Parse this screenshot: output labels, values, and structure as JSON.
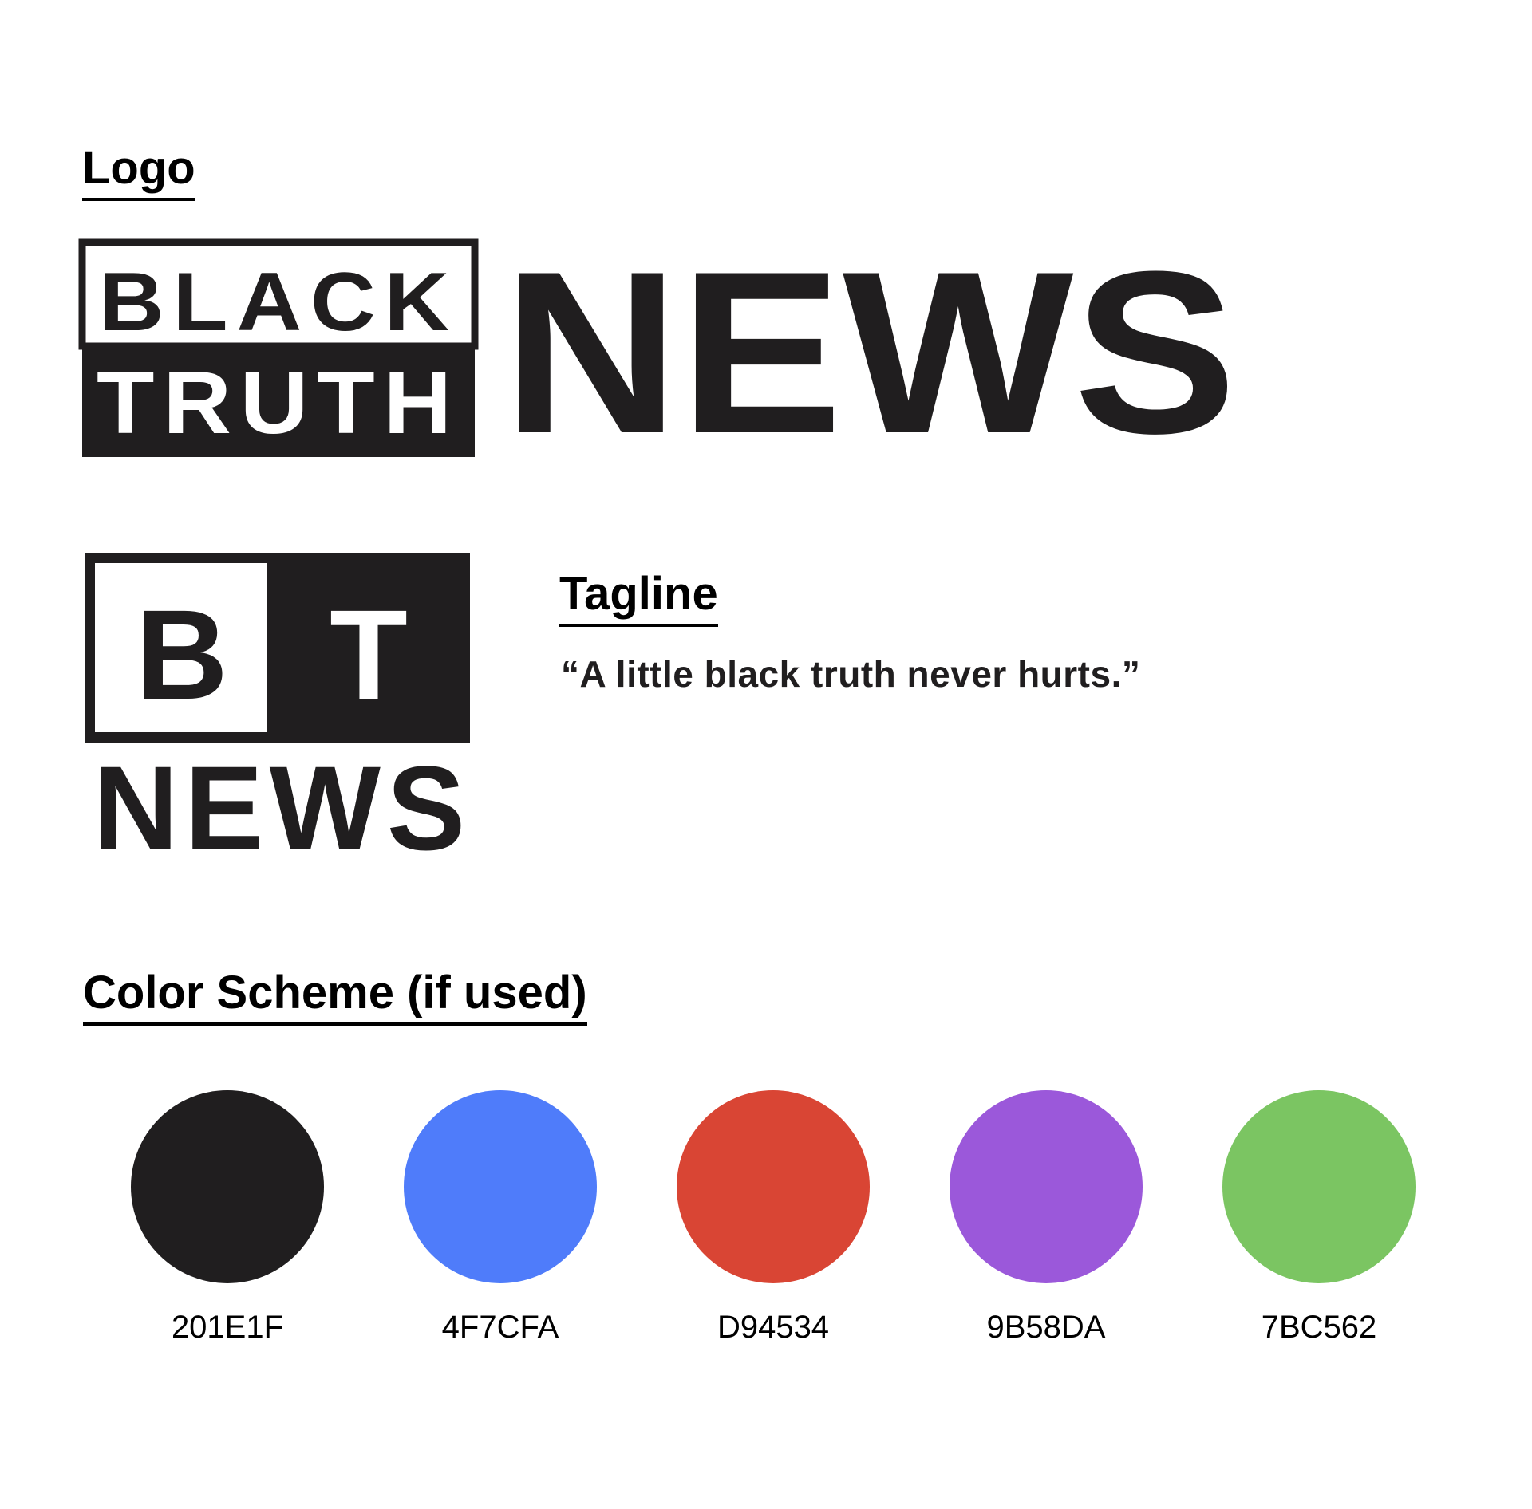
{
  "headings": {
    "logo": "Logo",
    "tagline": "Tagline",
    "color_scheme": "Color Scheme (if used)"
  },
  "logo": {
    "primary": {
      "word_black": "BLACK",
      "word_truth": "TRUTH",
      "word_news": "NEWS"
    },
    "secondary": {
      "letter_b": "B",
      "letter_t": "T",
      "word_news": "NEWS"
    },
    "colors": {
      "ink": "#201E1F",
      "paper": "#FFFFFF"
    }
  },
  "tagline": {
    "text": "“A little black truth never hurts.”"
  },
  "color_scheme": {
    "swatches": [
      {
        "hex": "201E1F",
        "color": "#201E1F"
      },
      {
        "hex": "4F7CFA",
        "color": "#4F7CFA"
      },
      {
        "hex": "D94534",
        "color": "#D94534"
      },
      {
        "hex": "9B58DA",
        "color": "#9B58DA"
      },
      {
        "hex": "7BC562",
        "color": "#7BC562"
      }
    ]
  }
}
